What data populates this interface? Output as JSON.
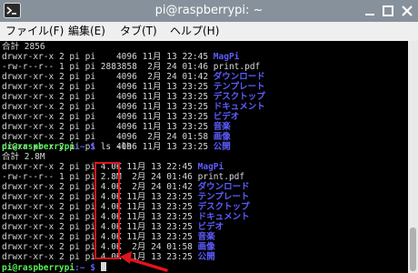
{
  "window": {
    "title": "pi@raspberrypi: ~"
  },
  "menu": {
    "items": [
      "ファイル(F)",
      "編集(E)",
      "タブ(T)",
      "ヘルプ(H)"
    ]
  },
  "icons": {
    "app": "terminal-icon",
    "minimize": "minimize-icon",
    "maximize": "maximize-icon",
    "close": "close-icon",
    "arrow": "red-arrow-icon"
  },
  "colors": {
    "titlebar": "#87919b",
    "terminal_bg": "#000000",
    "terminal_text": "#d8d8d8",
    "directory": "#5c5cff",
    "prompt": "#5af05a",
    "highlight": "#e0141c"
  },
  "terminal": {
    "listing1": {
      "total": "合計 2856",
      "rows": [
        {
          "perm": "drwxr-xr-x",
          "links": "2",
          "user": "pi",
          "group": "pi",
          "size": "   4096",
          "month": "11月",
          "day": "13",
          "time": "22:45",
          "name": "MagPi",
          "is_dir": true
        },
        {
          "perm": "-rw-r--r--",
          "links": "1",
          "user": "pi",
          "group": "pi",
          "size": "2883858",
          "month": " 2月",
          "day": "24",
          "time": "01:46",
          "name": "print.pdf",
          "is_dir": false
        },
        {
          "perm": "drwxr-xr-x",
          "links": "2",
          "user": "pi",
          "group": "pi",
          "size": "   4096",
          "month": " 2月",
          "day": "24",
          "time": "01:42",
          "name": "ダウンロード",
          "is_dir": true
        },
        {
          "perm": "drwxr-xr-x",
          "links": "2",
          "user": "pi",
          "group": "pi",
          "size": "   4096",
          "month": "11月",
          "day": "13",
          "time": "23:25",
          "name": "テンプレート",
          "is_dir": true
        },
        {
          "perm": "drwxr-xr-x",
          "links": "2",
          "user": "pi",
          "group": "pi",
          "size": "   4096",
          "month": "11月",
          "day": "13",
          "time": "23:25",
          "name": "デスクトップ",
          "is_dir": true
        },
        {
          "perm": "drwxr-xr-x",
          "links": "2",
          "user": "pi",
          "group": "pi",
          "size": "   4096",
          "month": "11月",
          "day": "13",
          "time": "23:25",
          "name": "ドキュメント",
          "is_dir": true
        },
        {
          "perm": "drwxr-xr-x",
          "links": "2",
          "user": "pi",
          "group": "pi",
          "size": "   4096",
          "month": "11月",
          "day": "13",
          "time": "23:25",
          "name": "ビデオ",
          "is_dir": true
        },
        {
          "perm": "drwxr-xr-x",
          "links": "2",
          "user": "pi",
          "group": "pi",
          "size": "   4096",
          "month": "11月",
          "day": "13",
          "time": "23:25",
          "name": "音楽",
          "is_dir": true
        },
        {
          "perm": "drwxr-xr-x",
          "links": "2",
          "user": "pi",
          "group": "pi",
          "size": "   4096",
          "month": " 2月",
          "day": "24",
          "time": "01:58",
          "name": "画像",
          "is_dir": true
        },
        {
          "perm": "drwxr-xr-x",
          "links": "2",
          "user": "pi",
          "group": "pi",
          "size": "   4096",
          "month": "11月",
          "day": "13",
          "time": "23:25",
          "name": "公開",
          "is_dir": true
        }
      ]
    },
    "command": {
      "user_host": "pi@raspberrypi",
      "path": ":~ $",
      "text": " ls -lh"
    },
    "listing2": {
      "total": "合計 2.8M",
      "rows": [
        {
          "perm": "drwxr-xr-x",
          "links": "2",
          "user": "pi",
          "group": "pi",
          "size": "4.0K",
          "month": "11月",
          "day": "13",
          "time": "22:45",
          "name": "MagPi",
          "is_dir": true
        },
        {
          "perm": "-rw-r--r--",
          "links": "1",
          "user": "pi",
          "group": "pi",
          "size": "2.8M",
          "month": " 2月",
          "day": "24",
          "time": "01:46",
          "name": "print.pdf",
          "is_dir": false
        },
        {
          "perm": "drwxr-xr-x",
          "links": "2",
          "user": "pi",
          "group": "pi",
          "size": "4.0K",
          "month": " 2月",
          "day": "24",
          "time": "01:42",
          "name": "ダウンロード",
          "is_dir": true
        },
        {
          "perm": "drwxr-xr-x",
          "links": "2",
          "user": "pi",
          "group": "pi",
          "size": "4.0K",
          "month": "11月",
          "day": "13",
          "time": "23:25",
          "name": "テンプレート",
          "is_dir": true
        },
        {
          "perm": "drwxr-xr-x",
          "links": "2",
          "user": "pi",
          "group": "pi",
          "size": "4.0K",
          "month": "11月",
          "day": "13",
          "time": "23:25",
          "name": "デスクトップ",
          "is_dir": true
        },
        {
          "perm": "drwxr-xr-x",
          "links": "2",
          "user": "pi",
          "group": "pi",
          "size": "4.0K",
          "month": "11月",
          "day": "13",
          "time": "23:25",
          "name": "ドキュメント",
          "is_dir": true
        },
        {
          "perm": "drwxr-xr-x",
          "links": "2",
          "user": "pi",
          "group": "pi",
          "size": "4.0K",
          "month": "11月",
          "day": "13",
          "time": "23:25",
          "name": "ビデオ",
          "is_dir": true
        },
        {
          "perm": "drwxr-xr-x",
          "links": "2",
          "user": "pi",
          "group": "pi",
          "size": "4.0K",
          "month": "11月",
          "day": "13",
          "time": "23:25",
          "name": "音楽",
          "is_dir": true
        },
        {
          "perm": "drwxr-xr-x",
          "links": "2",
          "user": "pi",
          "group": "pi",
          "size": "4.0K",
          "month": " 2月",
          "day": "24",
          "time": "01:58",
          "name": "画像",
          "is_dir": true
        },
        {
          "perm": "drwxr-xr-x",
          "links": "2",
          "user": "pi",
          "group": "pi",
          "size": "4.0K",
          "month": "11月",
          "day": "13",
          "time": "23:25",
          "name": "公開",
          "is_dir": true
        }
      ]
    },
    "final_prompt": {
      "user_host": "pi@raspberrypi",
      "path": ":~ $"
    }
  }
}
